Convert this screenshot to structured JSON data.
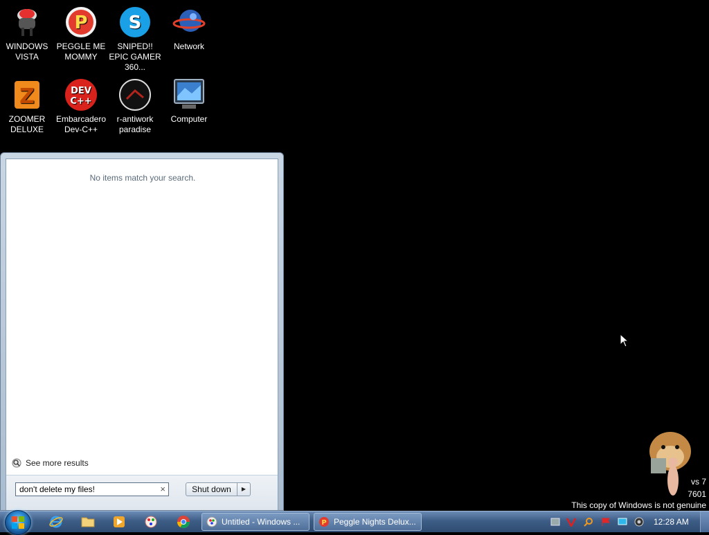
{
  "desktop": {
    "icons": [
      {
        "label": "WINDOWS VISTA",
        "icon": "red-gumball-machine-icon"
      },
      {
        "label": "PEGGLE ME MOMMY",
        "icon": "peggle-p-icon"
      },
      {
        "label": "SNIPED!! EPIC GAMER 360...",
        "icon": "skype-icon"
      },
      {
        "label": "Network",
        "icon": "network-globe-icon"
      },
      {
        "label": "ZOOMER DELUXE",
        "icon": "zuma-frog-icon"
      },
      {
        "label": "Embarcadero Dev-C++",
        "icon": "dev-cpp-icon"
      },
      {
        "label": "r-antiwork paradise",
        "icon": "antiwork-dark-circle-icon"
      },
      {
        "label": "Computer",
        "icon": "computer-monitor-icon"
      }
    ]
  },
  "start_menu": {
    "no_results_text": "No items match your search.",
    "see_more_results": "See more results",
    "search_value": "don't delete my files!",
    "clear_symbol": "×",
    "shutdown_label": "Shut down",
    "shutdown_arrow": "▶"
  },
  "taskbar": {
    "pinned": [
      "internet-explorer-icon",
      "folder-icon",
      "media-player-icon",
      "paint-icon",
      "chrome-icon"
    ],
    "tasks": [
      {
        "label": "Untitled - Windows ...",
        "icon": "paint-app-icon"
      },
      {
        "label": "Peggle Nights Delux...",
        "icon": "peggle-app-icon"
      }
    ],
    "clock": "12:28 AM"
  },
  "watermark": {
    "line1": "vs 7",
    "line2": "7601",
    "line3": "This copy of Windows is not genuine"
  },
  "colors": {
    "desktop_bg": "#000000",
    "taskbar": "#3e5d86",
    "start_menu_frame": "#b4c5d7"
  }
}
